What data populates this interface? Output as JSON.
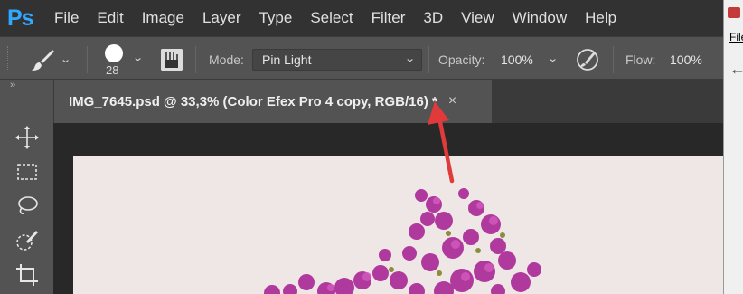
{
  "app": {
    "logo": "Ps",
    "accent": "#31a8ff"
  },
  "menu": [
    "File",
    "Edit",
    "Image",
    "Layer",
    "Type",
    "Select",
    "Filter",
    "3D",
    "View",
    "Window",
    "Help"
  ],
  "options": {
    "tool_icon": "brush-icon",
    "brush_size": "28",
    "mode_label": "Mode:",
    "mode_value": "Pin Light",
    "opacity_label": "Opacity:",
    "opacity_value": "100%",
    "flow_label": "Flow:",
    "flow_value": "100%"
  },
  "toolbar": {
    "collapse": "››",
    "tools": [
      "move-tool-icon",
      "marquee-tool-icon",
      "lasso-tool-icon",
      "quick-selection-tool-icon",
      "crop-tool-icon"
    ]
  },
  "document": {
    "tab_title": "IMG_7645.psd @ 33,3% (Color Efex Pro 4 copy, RGB/16) *",
    "close": "×"
  },
  "right_panel": {
    "file_label": "File"
  },
  "colors": {
    "annotation_arrow": "#e03a3a",
    "flowers": "#b0399e"
  }
}
